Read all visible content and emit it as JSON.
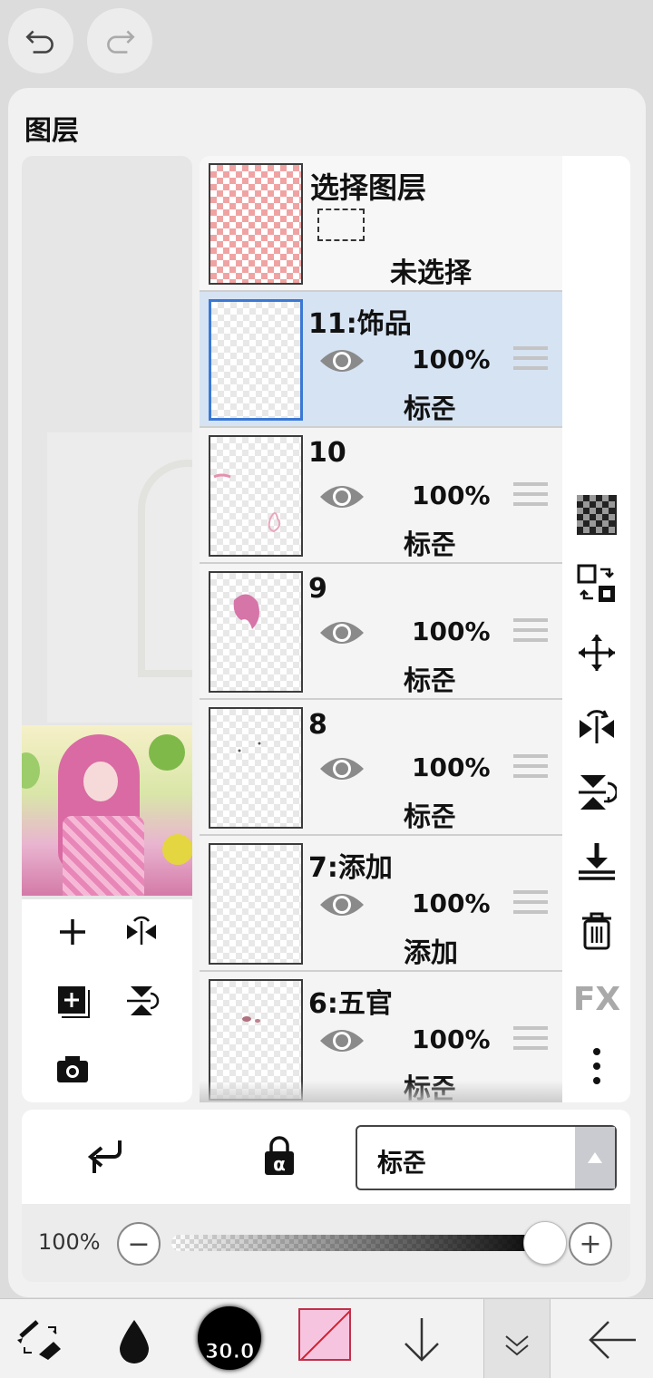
{
  "panel": {
    "title": "图层"
  },
  "select_layer": {
    "title": "选择图层",
    "status": "未选择"
  },
  "layers": [
    {
      "name": "11:饰品",
      "opacity": "100%",
      "blend": "标준"
    },
    {
      "name": "10",
      "opacity": "100%",
      "blend": "标준"
    },
    {
      "name": "9",
      "opacity": "100%",
      "blend": "标준"
    },
    {
      "name": "8",
      "opacity": "100%",
      "blend": "标준"
    },
    {
      "name": "7:添加",
      "opacity": "100%",
      "blend": "添加"
    },
    {
      "name": "6:五官",
      "opacity": "100%",
      "blend": "标준"
    }
  ],
  "blend_bar": {
    "mode": "标준"
  },
  "opacity_bar": {
    "label": "100%",
    "minus": "−",
    "plus": "+",
    "value": 1.0
  },
  "side_tools": {
    "fx_label": "FX"
  },
  "bottom_bar": {
    "brush_size": "30.0",
    "color": "#f7c4df"
  },
  "colors": {
    "selected_row": "#d6e3f3",
    "selected_border": "#3a78d4",
    "checker_pink": "#f0a3a3"
  }
}
